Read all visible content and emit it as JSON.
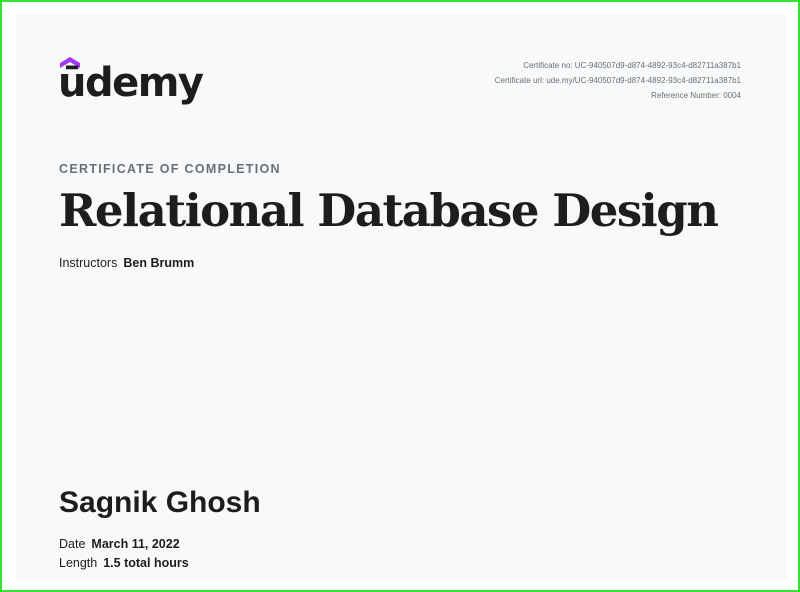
{
  "brand": {
    "logo_text": "ūdemy",
    "accent_color": "#a435f0"
  },
  "meta": {
    "certificate_no": "Certificate no: UC-940507d9-d874-4892-93c4-d82711a387b1",
    "certificate_url": "Certificate url: ude.my/UC-940507d9-d874-4892-93c4-d82711a387b1",
    "reference_number": "Reference Number: 0004"
  },
  "certificate": {
    "eyebrow": "CERTIFICATE OF COMPLETION",
    "course_title": "Relational Database Design",
    "instructors_label": "Instructors",
    "instructors_value": "Ben Brumm",
    "student_name": "Sagnik Ghosh",
    "date_label": "Date",
    "date_value": "March 11, 2022",
    "length_label": "Length",
    "length_value": "1.5 total hours"
  }
}
